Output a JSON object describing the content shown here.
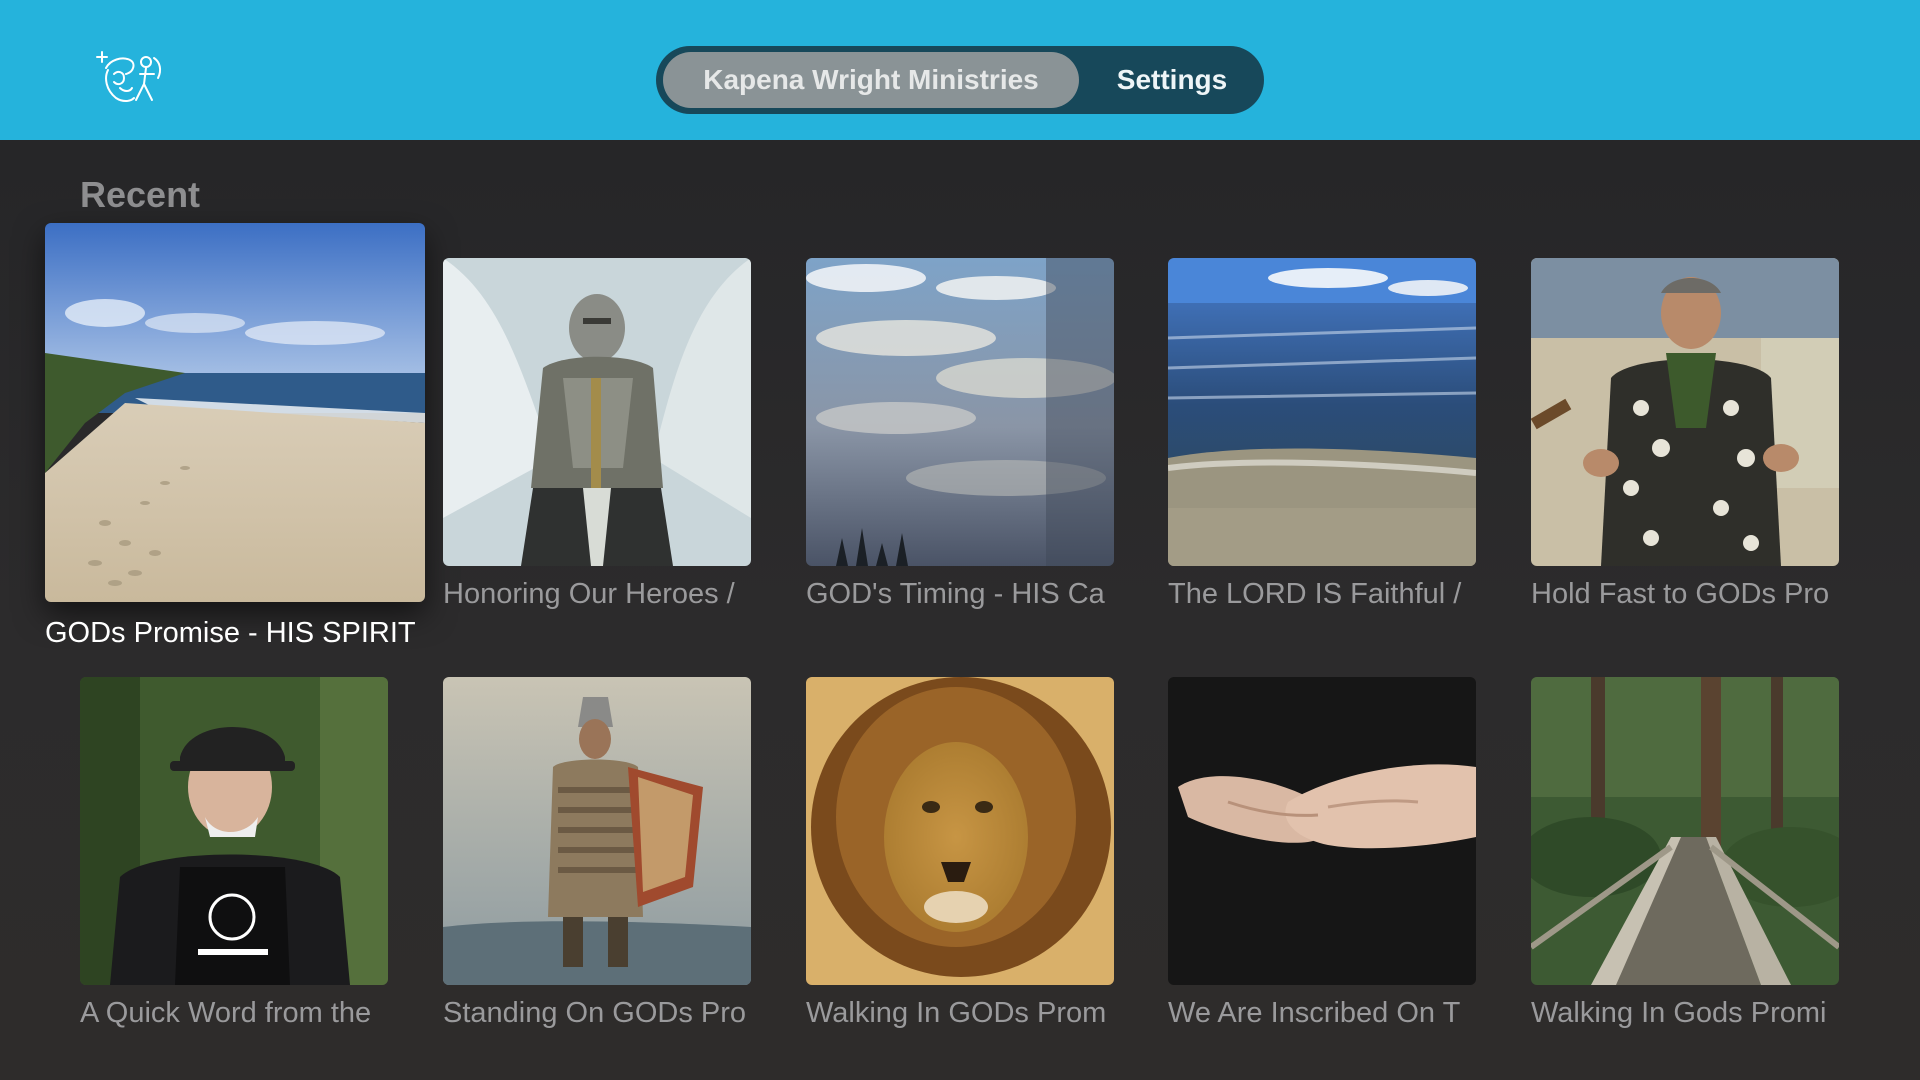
{
  "header": {
    "logo_icon": "ministry-logo-icon",
    "tabs": [
      {
        "label": "Kapena Wright Ministries",
        "selected": true
      },
      {
        "label": "Settings",
        "selected": false
      }
    ]
  },
  "section": {
    "title": "Recent"
  },
  "items": [
    {
      "title": "GODs Promise - HIS SPIRIT",
      "image": "beach with footprints",
      "focused": true
    },
    {
      "title": "Honoring Our Heroes /",
      "image": "armored angel knight"
    },
    {
      "title": "GOD's Timing - HIS Ca",
      "image": "cloudy sky"
    },
    {
      "title": "The LORD IS Faithful /",
      "image": "ocean waves"
    },
    {
      "title": "Hold Fast to GODs Pro",
      "image": "preacher in aloha shirt"
    },
    {
      "title": "A Quick Word from the",
      "image": "man in cap outdoors"
    },
    {
      "title": "Standing On GODs Pro",
      "image": "warrior with shield"
    },
    {
      "title": "Walking In GODs Prom",
      "image": "lion"
    },
    {
      "title": "We Are Inscribed On T",
      "image": "open hands"
    },
    {
      "title": "Walking In Gods Promi",
      "image": "forest footbridge"
    }
  ],
  "colors": {
    "header_bg": "#25b3dc",
    "segment_bg": "#17485a",
    "segment_active": "#8a9396",
    "page_bg": "#2a2a2c"
  }
}
